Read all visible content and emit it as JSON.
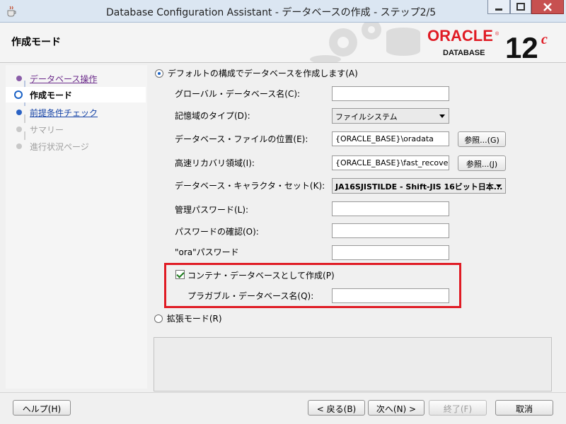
{
  "window": {
    "title": "Database Configuration Assistant - データベースの作成 - ステップ2/5",
    "icon": "java-cup-icon"
  },
  "header": {
    "step_title": "作成モード",
    "logo": {
      "brand": "ORACLE",
      "product": "DATABASE",
      "version": "12",
      "version_suffix": "c",
      "brand_color": "#e01b24"
    }
  },
  "nav": {
    "items": [
      {
        "label": "データベース操作",
        "state": "done"
      },
      {
        "label": "作成モード",
        "state": "current"
      },
      {
        "label": "前提条件チェック",
        "state": "link"
      },
      {
        "label": "サマリー",
        "state": "disabled"
      },
      {
        "label": "進行状況ページ",
        "state": "disabled"
      }
    ]
  },
  "main": {
    "default_mode_label": "デフォルトの構成でデータベースを作成します(A)",
    "fields": {
      "global_db_name_label": "グローバル・データベース名(C):",
      "global_db_name_value": "",
      "storage_type_label": "記憶域のタイプ(D):",
      "storage_type_value": "ファイルシステム",
      "db_file_location_label": "データベース・ファイルの位置(E):",
      "db_file_location_value": "{ORACLE_BASE}\\oradata",
      "db_file_browse_label": "参照...(G)",
      "fra_label": "高速リカバリ領域(I):",
      "fra_value": "{ORACLE_BASE}\\fast_recove",
      "fra_browse_label": "参照...(J)",
      "charset_label": "データベース・キャラクタ・セット(K):",
      "charset_value": "JA16SJISTILDE - Shift-JIS 16ビット日本...",
      "admin_password_label": "管理パスワード(L):",
      "confirm_password_label": "パスワードの確認(O):",
      "ora_password_label": "\"ora\"パスワード",
      "container_db_label": "コンテナ・データベースとして作成(P)",
      "container_db_checked": true,
      "pdb_name_label": "プラガブル・データベース名(Q):",
      "pdb_name_value": ""
    },
    "advanced_mode_label": "拡張モード(R)"
  },
  "buttons": {
    "help": "ヘルプ(H)",
    "back": "< 戻る(B)",
    "next": "次へ(N) >",
    "finish": "終了(F)",
    "cancel": "取消"
  },
  "colors": {
    "highlight_border": "#e01b24",
    "nav_current_bg": "#ffffff",
    "link_color": "#6b2a8a"
  }
}
